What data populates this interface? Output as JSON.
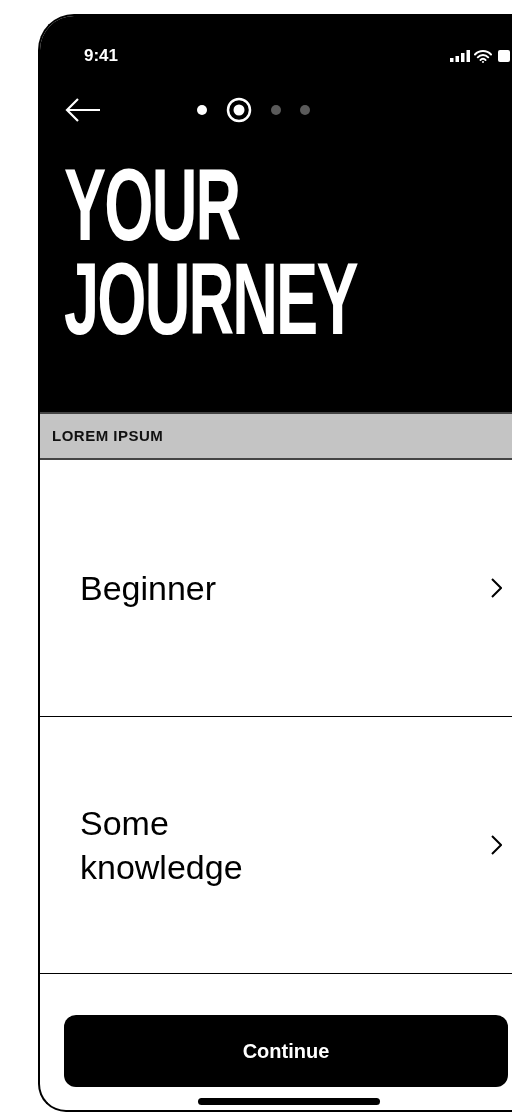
{
  "status_bar": {
    "time": "9:41"
  },
  "steps": [
    {
      "selected": false,
      "completed": true
    },
    {
      "selected": true,
      "completed": false
    },
    {
      "selected": false,
      "completed": false
    },
    {
      "selected": false,
      "completed": false
    }
  ],
  "title_lines": [
    "YOUR",
    "JOURNEY"
  ],
  "section_header": "LOREM IPSUM",
  "options": [
    {
      "label": "Beginner"
    },
    {
      "label": "Some knowledge"
    }
  ],
  "primary_button": "Continue"
}
